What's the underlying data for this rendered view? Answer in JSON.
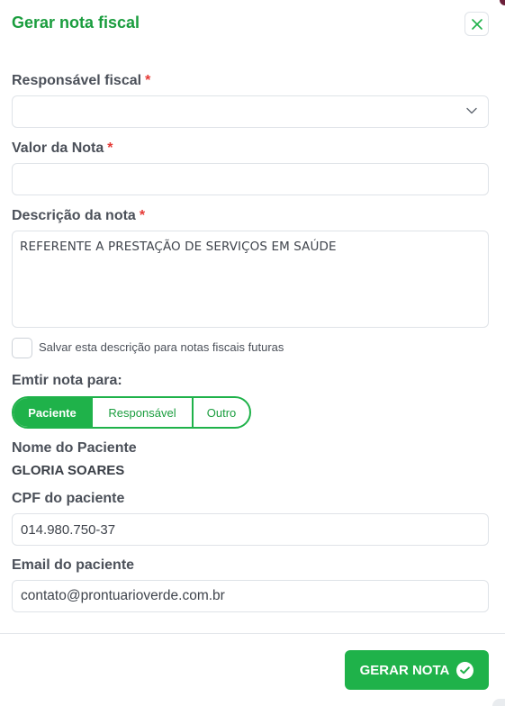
{
  "modal": {
    "title": "Gerar nota fiscal"
  },
  "fields": {
    "responsavel_label": "Responsável fiscal",
    "responsavel_value": "",
    "valor_label": "Valor da Nota",
    "valor_value": "",
    "descricao_label": "Descrição da nota",
    "descricao_value": "REFERENTE A PRESTAÇÃO DE SERVIÇOS EM SAÚDE",
    "required_mark": "*"
  },
  "checkbox": {
    "label": "Salvar esta descrição para notas fiscais futuras",
    "checked": false
  },
  "emitir": {
    "label": "Emtir nota para:",
    "options": [
      "Paciente",
      "Responsável",
      "Outro"
    ],
    "selected": "Paciente"
  },
  "paciente": {
    "nome_label": "Nome do Paciente",
    "nome_value": "GLORIA SOARES",
    "cpf_label": "CPF do paciente",
    "cpf_value": "014.980.750-37",
    "email_label": "Email do paciente",
    "email_value": "contato@prontuarioverde.com.br"
  },
  "footer": {
    "submit_label": "GERAR NOTA"
  },
  "colors": {
    "accent": "#1fb24a",
    "title": "#1a9d3e",
    "required": "#e53935"
  },
  "icons": {
    "close": "close-icon",
    "select": "chevron-down-icon",
    "submit": "check-circle-icon"
  }
}
